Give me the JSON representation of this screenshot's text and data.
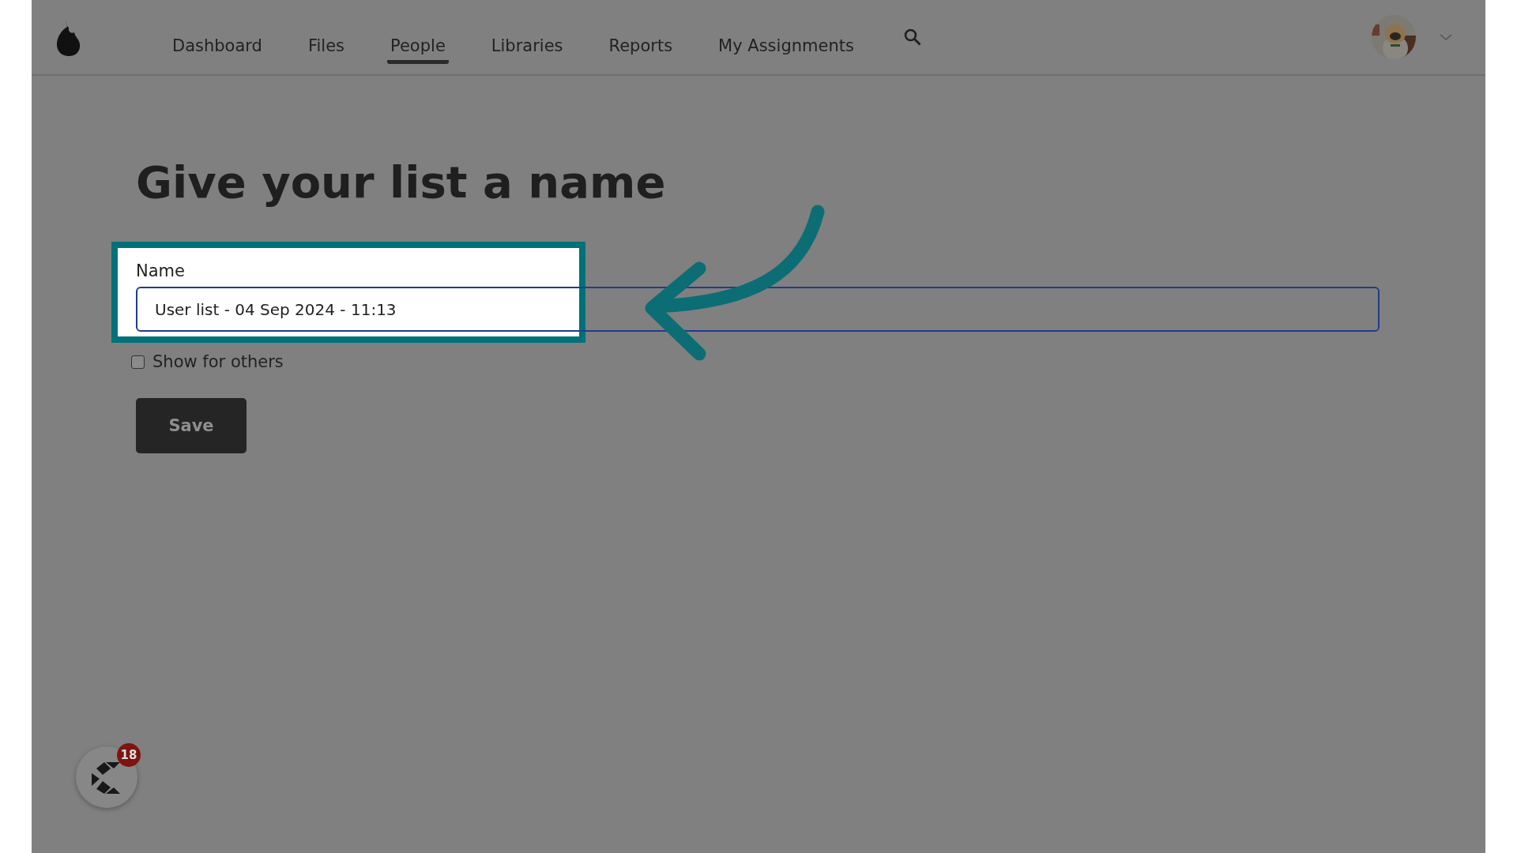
{
  "nav": {
    "items": [
      {
        "label": "Dashboard",
        "selected": false
      },
      {
        "label": "Files",
        "selected": false
      },
      {
        "label": "People",
        "selected": true
      },
      {
        "label": "Libraries",
        "selected": false
      },
      {
        "label": "Reports",
        "selected": false
      },
      {
        "label": "My Assignments",
        "selected": false
      }
    ]
  },
  "form": {
    "title": "Give your list a name",
    "field_label": "Name",
    "field_value": "User list - 04 Sep 2024 - 11:13",
    "share_checkbox": {
      "label": "Show for others",
      "checked": false
    },
    "save_button": "Save"
  },
  "chat_widget": {
    "badge": "18"
  }
}
